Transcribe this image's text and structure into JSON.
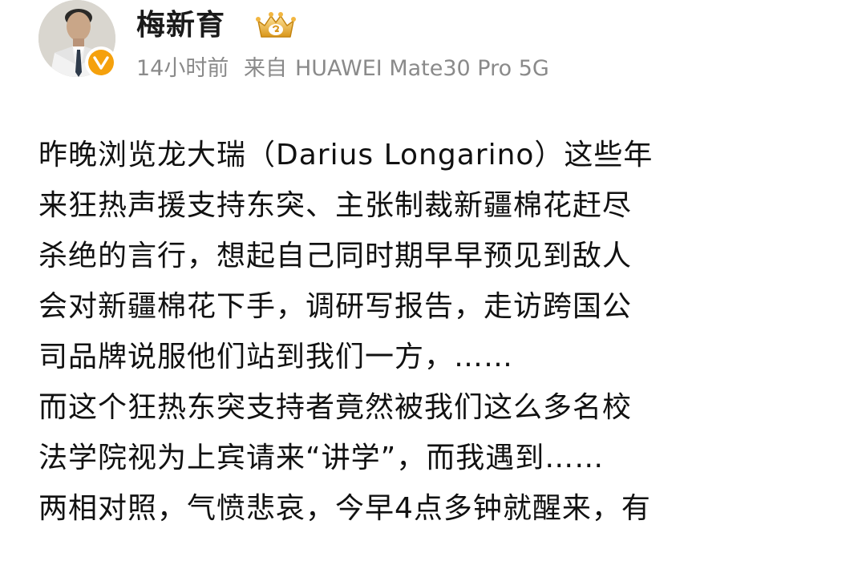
{
  "author": {
    "name": "梅新育",
    "avatar_icon": "person-photo-avatar",
    "verified_icon": "verified-v-icon",
    "level_icon": "crown-level-icon",
    "accent_color": "#f5a10d"
  },
  "meta": {
    "time": "14小时前",
    "source_prefix": "来自",
    "device": "HUAWEI Mate30 Pro 5G"
  },
  "post": {
    "lines": [
      "昨晚浏览龙大瑞（Darius Longarino）这些年",
      "来狂热声援支持东突、主张制裁新疆棉花赶尽",
      "杀绝的言行，想起自己同时期早早预见到敌人",
      "会对新疆棉花下手，调研写报告，走访跨国公",
      "司品牌说服他们站到我们一方，……",
      "而这个狂热东突支持者竟然被我们这么多名校",
      "法学院视为上宾请来“讲学”，而我遇到……",
      "两相对照，气愤悲哀，今早4点多钟就醒来，有"
    ]
  }
}
